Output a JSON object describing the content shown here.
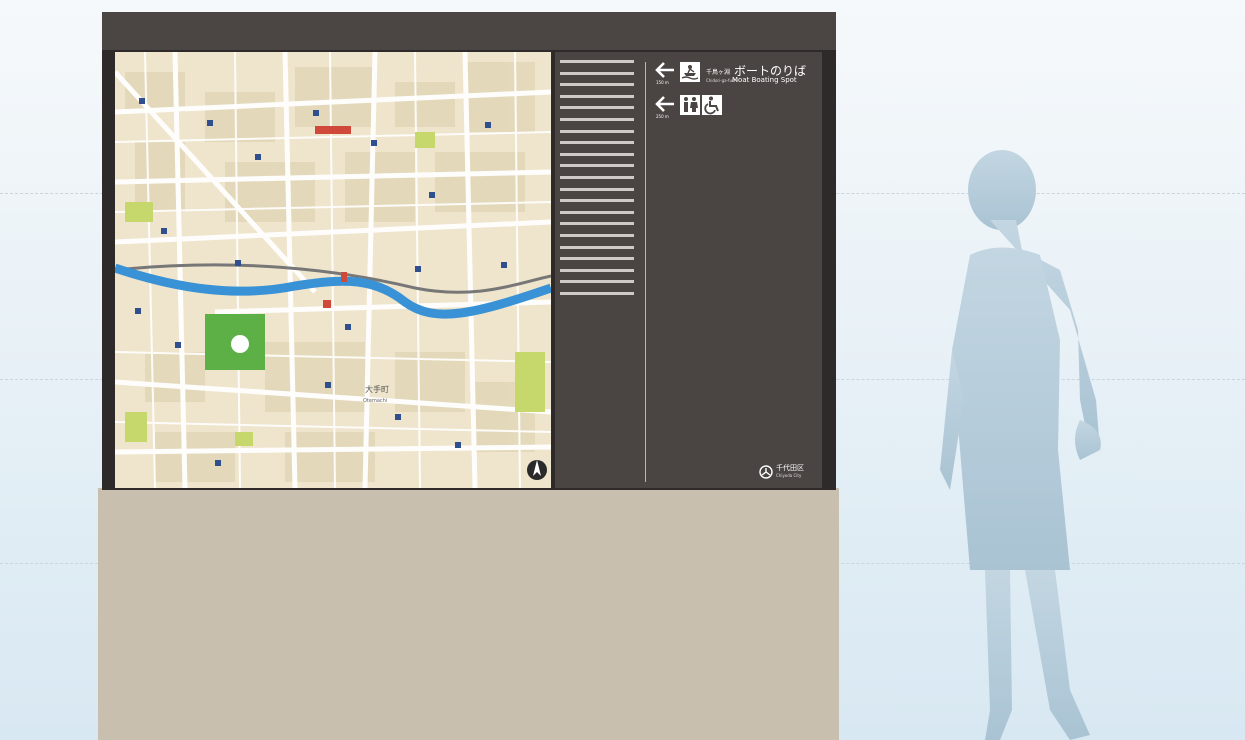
{
  "sign": {
    "boat_dist": "150 m",
    "boat_jp_small": "千鳥ヶ淵",
    "boat_jp_large": "ボートのりば",
    "boat_romaji": "Chidori-ga-fuchi",
    "boat_en": "Moat Boating Spot",
    "toilet_dist": "250 m",
    "city_jp": "千代田区",
    "city_en": "Chiyoda City"
  },
  "map": {
    "district_label": "大手町",
    "district_label_en": "Otemachi"
  },
  "colors": {
    "panel": "#4a4442",
    "frame": "#2f2b2a",
    "base": "#c9bfae",
    "map_bg": "#efe6cf",
    "river": "#3a92d6",
    "park": "#5cb045",
    "sky_top": "#f4f8fb",
    "sky_bottom": "#dceaf3",
    "silhouette": "#b9cfdc"
  },
  "icons": [
    "left-arrow-icon",
    "boat-icon",
    "toilet-icon",
    "wheelchair-icon",
    "city-emblem-icon",
    "north-arrow-icon"
  ]
}
